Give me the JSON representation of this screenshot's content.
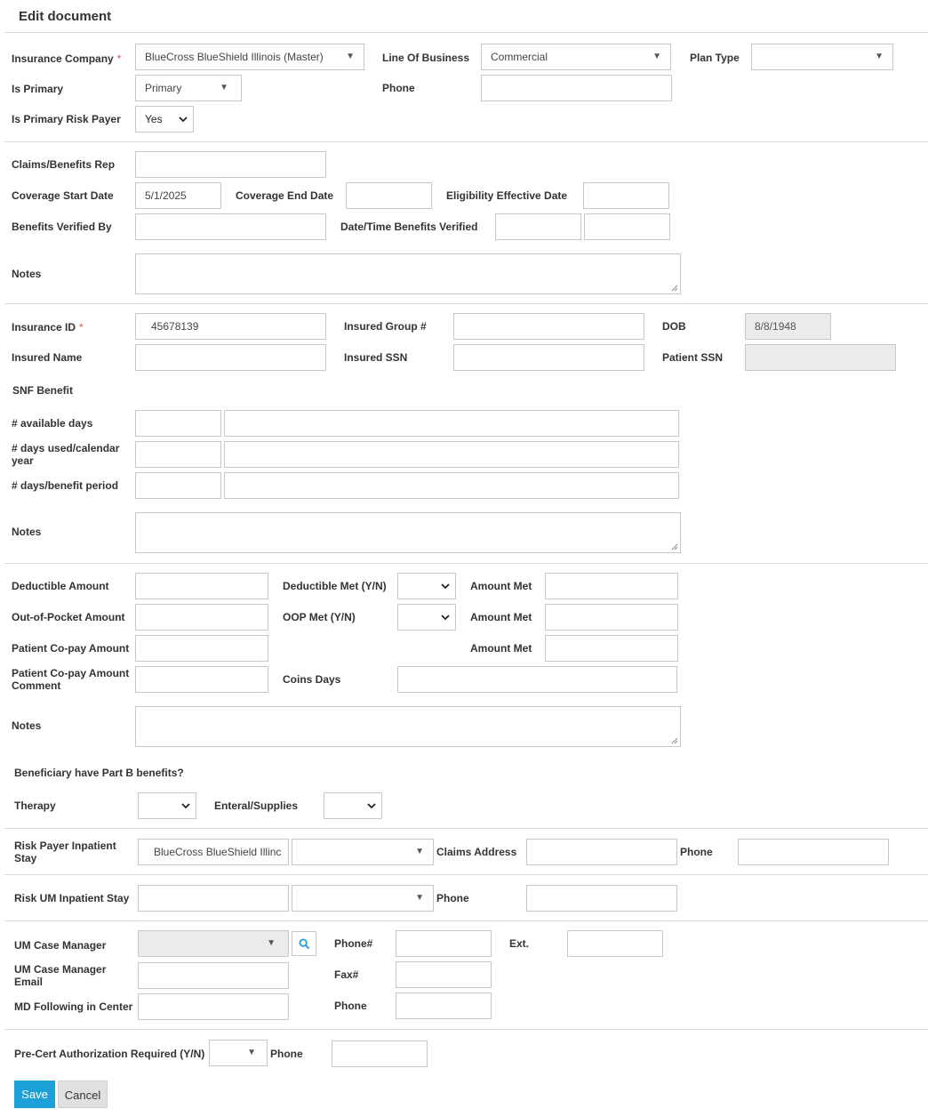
{
  "page_title": "Edit document",
  "insurance": {
    "company_label": "Insurance Company",
    "company_value": "BlueCross BlueShield Illinois (Master)",
    "lob_label": "Line Of Business",
    "lob_value": "Commercial",
    "plan_type_label": "Plan Type",
    "plan_type_value": "",
    "is_primary_label": "Is Primary",
    "is_primary_value": "Primary",
    "phone_label": "Phone",
    "phone_value": "",
    "risk_payer_label": "Is Primary Risk Payer",
    "risk_payer_value": "Yes"
  },
  "claims": {
    "rep_label": "Claims/Benefits Rep",
    "cov_start_label": "Coverage Start Date",
    "cov_start_value": "5/1/2025",
    "cov_end_label": "Coverage End Date",
    "elig_label": "Eligibility Effective Date",
    "verified_by_label": "Benefits Verified By",
    "datetime_label": "Date/Time Benefits Verified",
    "notes_label": "Notes"
  },
  "insured": {
    "id_label": "Insurance ID",
    "id_value": "45678139",
    "group_label": "Insured Group #",
    "dob_label": "DOB",
    "dob_value": "8/8/1948",
    "name_label": "Insured Name",
    "ssn_label": "Insured SSN",
    "patient_ssn_label": "Patient SSN",
    "snf_label": "SNF Benefit",
    "avail_label": "# available days",
    "used_label": "# days used/calendar year",
    "period_label": "# days/benefit period",
    "notes_label": "Notes"
  },
  "deductible": {
    "amount_label": "Deductible Amount",
    "met_label": "Deductible Met (Y/N)",
    "amount_met_label": "Amount Met",
    "oop_label": "Out-of-Pocket Amount",
    "oop_met_label": "OOP Met (Y/N)",
    "oop_amount_met_label": "Amount Met",
    "copay_label": "Patient Co-pay Amount",
    "copay_amount_met_label": "Amount Met",
    "copay_comment_label": "Patient Co-pay Amount Comment",
    "coins_label": "Coins Days",
    "notes_label": "Notes"
  },
  "part_b": {
    "question": "Beneficiary have Part B benefits?",
    "therapy_label": "Therapy",
    "enteral_label": "Enteral/Supplies"
  },
  "risk_payer": {
    "label": "Risk Payer Inpatient Stay",
    "value": "BlueCross BlueShield Illinc",
    "claims_address_label": "Claims Address",
    "phone_label": "Phone"
  },
  "risk_um": {
    "label": "Risk UM Inpatient Stay",
    "phone_label": "Phone"
  },
  "um": {
    "manager_label": "UM Case Manager",
    "phone_label": "Phone#",
    "ext_label": "Ext.",
    "email_label": "UM Case Manager Email",
    "fax_label": "Fax#",
    "md_label": "MD Following in Center",
    "md_phone_label": "Phone"
  },
  "precert": {
    "label": "Pre-Cert Authorization Required (Y/N)",
    "phone_label": "Phone"
  },
  "buttons": {
    "save": "Save",
    "cancel": "Cancel"
  },
  "colors": {
    "save_bg": "#1ba1d8",
    "cancel_bg": "#e0e0e0",
    "required": "#d9534f",
    "search_icon": "#2e9bd6"
  },
  "icons": {
    "search": "magnifier-icon",
    "dropdown": "triangle-down-icon"
  }
}
